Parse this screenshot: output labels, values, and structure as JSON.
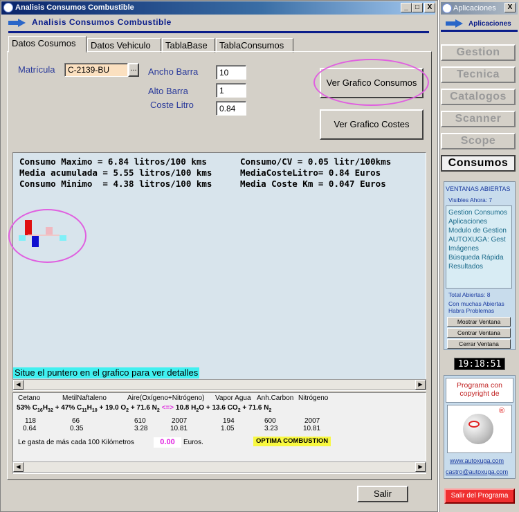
{
  "main_window": {
    "title": "Analisis Consumos Combustible",
    "header_title": "Analisis Consumos Combustible",
    "controls": [
      "_",
      "□",
      "X"
    ]
  },
  "tabs": [
    "Datos Cosumos",
    "Datos Vehiculo",
    "TablaBase",
    "TablaConsumos"
  ],
  "form": {
    "matricula_label": "Matrícula",
    "matricula_value": "C-2139-BU",
    "lookup_button": "...",
    "ancho_label": "Ancho Barra",
    "ancho_value": "10",
    "alto_label": "Alto Barra",
    "alto_value": "1",
    "coste_label": "Coste Litro",
    "coste_value": "0.84"
  },
  "buttons": {
    "ver_consumos": "Ver Grafico Consumos",
    "ver_costes": "Ver Grafico Costes",
    "salir": "Salir"
  },
  "stats": {
    "line1": "Consumo Maximo = 6.84 litros/100 kms",
    "line2": "Media acumulada = 5.55 litros/100 kms",
    "line3": "Consumo Minimo  = 4.38 litros/100 kms",
    "line4": "Consumo/CV = 0.05 litr/100kms",
    "line5": "MediaCosteLitro= 0.84 Euros",
    "line6": "Media Coste Km = 0.047 Euros"
  },
  "hint": "Situe el puntero en el grafico para ver detalles",
  "chemistry": {
    "headers": [
      "Cetano",
      "MetilNaftaleno",
      "Aire(Oxígeno+Nitrógeno)",
      "Vapor Agua",
      "Anh.Carbon",
      "Nitrógeno"
    ],
    "eq_p1": "53% C",
    "eq_p1_sub1": "16",
    "eq_p1_mid": "H",
    "eq_p1_sub2": "32",
    "eq_p2": "+ 47% C",
    "eq_p2_sub1": "11",
    "eq_p2_mid": "H",
    "eq_p2_sub2": "10",
    "eq_p3": "+ 19.0 O",
    "eq_p3_sub": "2",
    "eq_p4": "+ 71.6 N",
    "eq_p4_sub": "2",
    "eq_arrow": "<=>",
    "eq_p5": "10.8 H",
    "eq_p5_sub": "2",
    "eq_p5_end": "O",
    "eq_p6": "+ 13.6 CO",
    "eq_p6_sub": "2",
    "eq_p7": "+ 71.6 N",
    "eq_p7_sub": "2",
    "row1": [
      "118",
      "66",
      "610",
      "2007",
      "194",
      "600",
      "2007"
    ],
    "row2": [
      "0.64",
      "0.35",
      "3.28",
      "10.81",
      "1.05",
      "3.23",
      "10.81"
    ],
    "extra_label": "Le gasta de más cada 100 Kilómetros",
    "extra_value": "0.00",
    "extra_unit": "Euros.",
    "status": "OPTIMA COMBUSTION"
  },
  "sidebar": {
    "title": "Aplicaciones",
    "close": "X",
    "header": "Aplicaciones",
    "nav": [
      "Gestion",
      "Tecnica",
      "Catalogos",
      "Scanner",
      "Scope",
      "Consumos"
    ],
    "windows_title": "VENTANAS ABIERTAS",
    "visible": "Visibles Ahora: 7",
    "windows": [
      "Gestion Consumos",
      "Aplicaciones",
      "Modulo de Gestion",
      "AUTOXUGA:  Gest",
      "Imágenes",
      "Búsqueda Rápida",
      "Resultados"
    ],
    "total": "Total Abiertas: 8",
    "warning1": "Con muchas Abiertas",
    "warning2": "Habra Problemas",
    "btn_mostrar": "Mostrar Ventana",
    "btn_centrar": "Centrar Ventana",
    "btn_cerrar": "Cerrar Ventana",
    "clock": "19:18:51",
    "copyright1": "Programa con",
    "copyright2": "copyright de",
    "reg": "®",
    "web": "www.autoxuga.com",
    "email": "castro@autoxuga.com",
    "exit": "Salir del Programa"
  },
  "colors": {
    "title_bar": "#0a246a",
    "bar_red": "#e01010",
    "bar_blue": "#1010d0",
    "bar_pink": "#f0b8c0",
    "bar_cyan": "#80f0f8",
    "hint_bg": "#40f0f0",
    "status_bg": "#f8f840",
    "exit_bg": "#f03030",
    "highlight_circle": "#e060e0"
  },
  "chart_bars": [
    {
      "color": "#e01010",
      "value": 6.84
    },
    {
      "color": "#1010d0",
      "value": 4.38
    },
    {
      "color": "#f0b8c0",
      "value": 5.55
    },
    {
      "color": "#80f0f8",
      "value": 5.55
    }
  ]
}
